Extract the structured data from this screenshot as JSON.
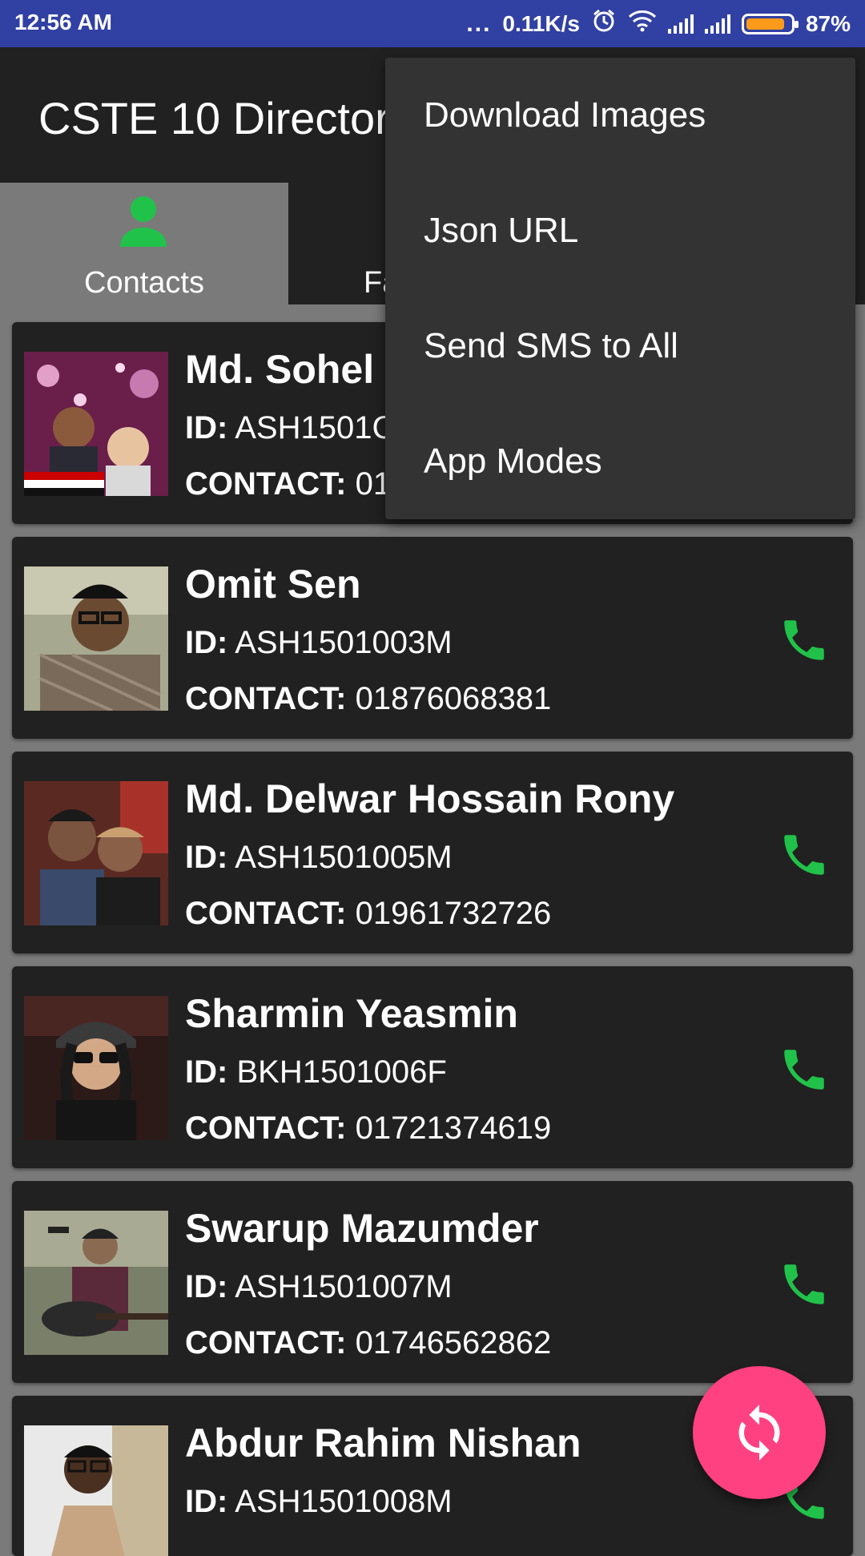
{
  "status_bar": {
    "time": "12:56 AM",
    "dots": "...",
    "speed": "0.11K/s",
    "battery_percent": "87%",
    "battery_level": 0.87,
    "icons": [
      "alarm-icon",
      "wifi-icon",
      "signal-icon",
      "signal-icon",
      "battery-icon"
    ]
  },
  "app_bar": {
    "title": "CSTE 10 Directory"
  },
  "tabs": [
    {
      "label": "Contacts",
      "icon": "person-icon",
      "active": true
    },
    {
      "label": "Fa",
      "active": false
    }
  ],
  "overflow_menu": {
    "items": [
      "Download Images",
      "Json URL",
      "Send SMS to All",
      "App Modes"
    ]
  },
  "contacts": {
    "id_label": "ID:",
    "contact_label": "CONTACT:",
    "items": [
      {
        "name": "Md. Sohel",
        "id": "ASH1501C",
        "contact": "01"
      },
      {
        "name": "Omit Sen",
        "id": "ASH1501003M",
        "contact": "01876068381"
      },
      {
        "name": "Md. Delwar Hossain Rony",
        "id": "ASH1501005M",
        "contact": "01961732726"
      },
      {
        "name": "Sharmin Yeasmin",
        "id": "BKH1501006F",
        "contact": "01721374619"
      },
      {
        "name": "Swarup Mazumder",
        "id": "ASH1501007M",
        "contact": "01746562862"
      },
      {
        "name": "Abdur Rahim Nishan",
        "id": "ASH1501008M",
        "contact": ""
      }
    ]
  },
  "fab": {
    "icon": "refresh-icon"
  },
  "colors": {
    "status_bar": "#3140a3",
    "app_bar": "#212121",
    "card": "#212121",
    "accent_green": "#21c24a",
    "fab": "#ff4081",
    "menu": "#333333"
  }
}
